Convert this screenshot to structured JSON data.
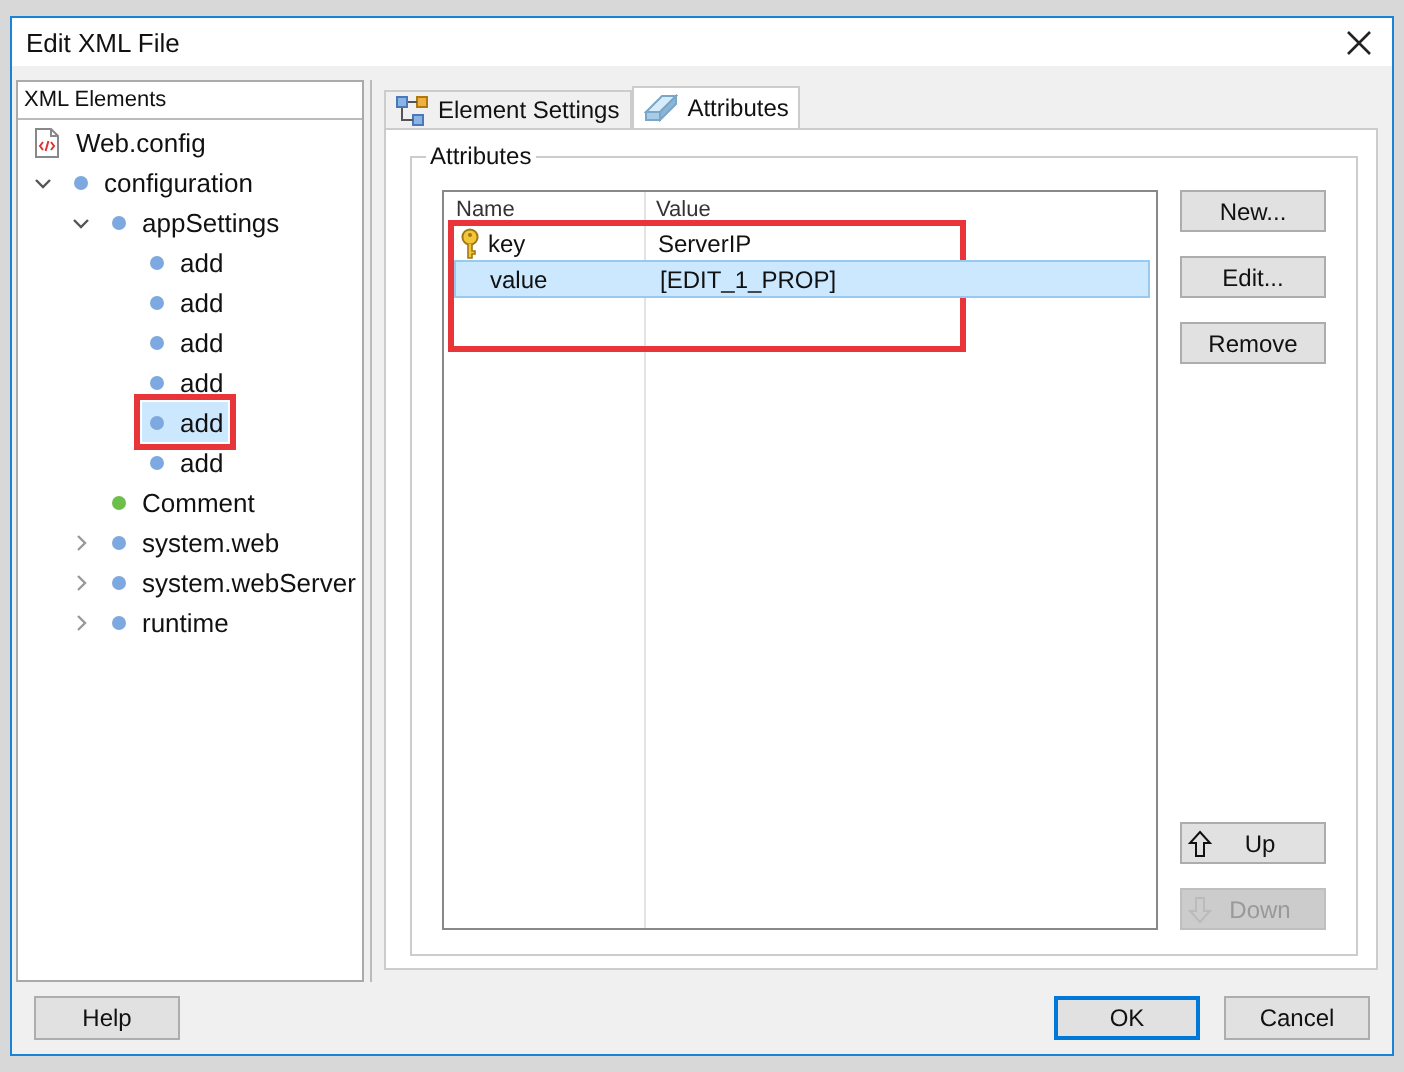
{
  "window": {
    "title": "Edit XML File"
  },
  "tree": {
    "header": "XML Elements",
    "items": [
      {
        "label": "Web.config",
        "kind": "file",
        "selected": false,
        "highlighted": false,
        "children": [
          {
            "label": "configuration",
            "kind": "element",
            "expanded": true,
            "selected": false,
            "highlighted": false,
            "children": [
              {
                "label": "appSettings",
                "kind": "element",
                "expanded": true,
                "selected": false,
                "highlighted": false,
                "children": [
                  {
                    "label": "add",
                    "kind": "element",
                    "selected": false,
                    "highlighted": false
                  },
                  {
                    "label": "add",
                    "kind": "element",
                    "selected": false,
                    "highlighted": false
                  },
                  {
                    "label": "add",
                    "kind": "element",
                    "selected": false,
                    "highlighted": false
                  },
                  {
                    "label": "add",
                    "kind": "element",
                    "selected": false,
                    "highlighted": false
                  },
                  {
                    "label": "add",
                    "kind": "element",
                    "selected": true,
                    "highlighted": true
                  },
                  {
                    "label": "add",
                    "kind": "element",
                    "selected": false,
                    "highlighted": false
                  }
                ]
              },
              {
                "label": "Comment",
                "kind": "comment",
                "selected": false,
                "highlighted": false
              },
              {
                "label": "system.web",
                "kind": "element",
                "expanded": false,
                "selected": false,
                "highlighted": false
              },
              {
                "label": "system.webServer",
                "kind": "element",
                "expanded": false,
                "selected": false,
                "highlighted": false
              },
              {
                "label": "runtime",
                "kind": "element",
                "expanded": false,
                "selected": false,
                "highlighted": false
              }
            ]
          }
        ]
      }
    ]
  },
  "tabs": [
    {
      "label": "Element Settings",
      "selected": false
    },
    {
      "label": "Attributes",
      "selected": true
    }
  ],
  "attributes": {
    "group_title": "Attributes",
    "columns": [
      "Name",
      "Value"
    ],
    "highlighted": true,
    "rows": [
      {
        "name": "key",
        "value": "ServerIP",
        "is_key": true,
        "selected": false
      },
      {
        "name": "value",
        "value": "[EDIT_1_PROP]",
        "is_key": false,
        "selected": true
      }
    ],
    "buttons": [
      {
        "label": "New...",
        "disabled": false
      },
      {
        "label": "Edit...",
        "disabled": false
      },
      {
        "label": "Remove",
        "disabled": false
      }
    ],
    "move_buttons": [
      {
        "label": "Up",
        "kind": "up",
        "disabled": false
      },
      {
        "label": "Down",
        "kind": "down",
        "disabled": true
      }
    ]
  },
  "footer": {
    "help": "Help",
    "ok": "OK",
    "cancel": "Cancel"
  }
}
